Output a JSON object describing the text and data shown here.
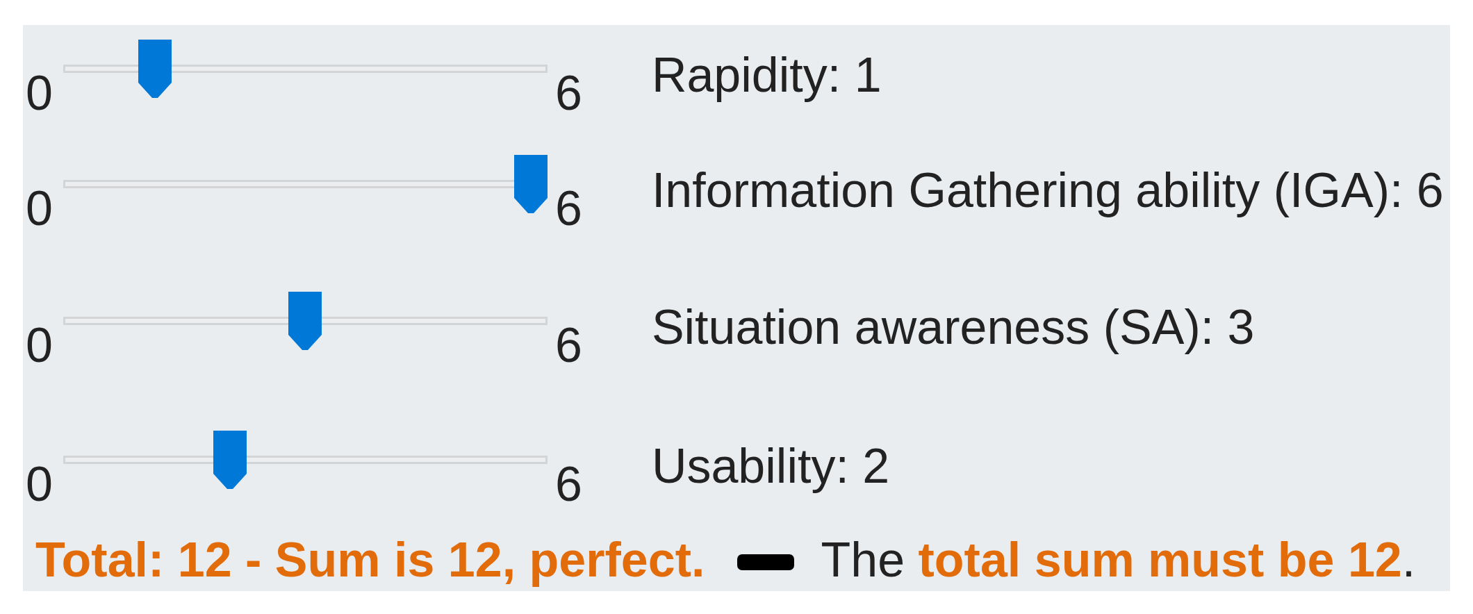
{
  "sliders": [
    {
      "min_label": "0",
      "max_label": "6",
      "level": 0.1667,
      "label": "Rapidity: 1"
    },
    {
      "min_label": "0",
      "max_label": "6",
      "level": 1,
      "label": "Information Gathering ability (IGA): 6"
    },
    {
      "min_label": "0",
      "max_label": "6",
      "level": 0.5,
      "label": "Situation awareness (SA): 3"
    },
    {
      "min_label": "0",
      "max_label": "6",
      "level": 0.3333,
      "label": "Usability: 2"
    }
  ],
  "total_line": {
    "status": "Total: 12 - Sum is 12, perfect.",
    "rule": "The **total sum must be 12**."
  }
}
